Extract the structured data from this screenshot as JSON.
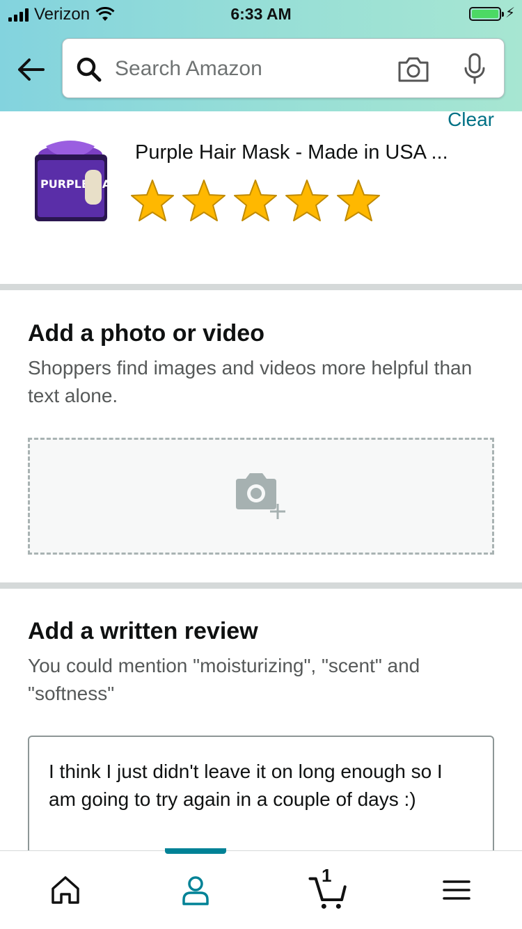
{
  "status_bar": {
    "carrier": "Verizon",
    "time": "6:33 AM"
  },
  "search": {
    "placeholder": "Search Amazon"
  },
  "product": {
    "clear_label": "Clear",
    "title": "Purple Hair Mask - Made in USA ...",
    "image_label": "PURPLE HAIR MASK",
    "rating": 5,
    "max_rating": 5
  },
  "photo_section": {
    "title": "Add a photo or video",
    "subtitle": "Shoppers find images and videos more helpful than text alone."
  },
  "review_section": {
    "title": "Add a written review",
    "subtitle": "You could mention \"moisturizing\", \"scent\" and \"softness\"",
    "text": "I think I just didn't leave it on long enough so I am going to try again in a couple of days :)"
  },
  "tabbar": {
    "cart_count": "1",
    "active_tab": "account"
  },
  "colors": {
    "accent": "#007185",
    "active_tab": "#008296",
    "star": "#ffb800"
  }
}
